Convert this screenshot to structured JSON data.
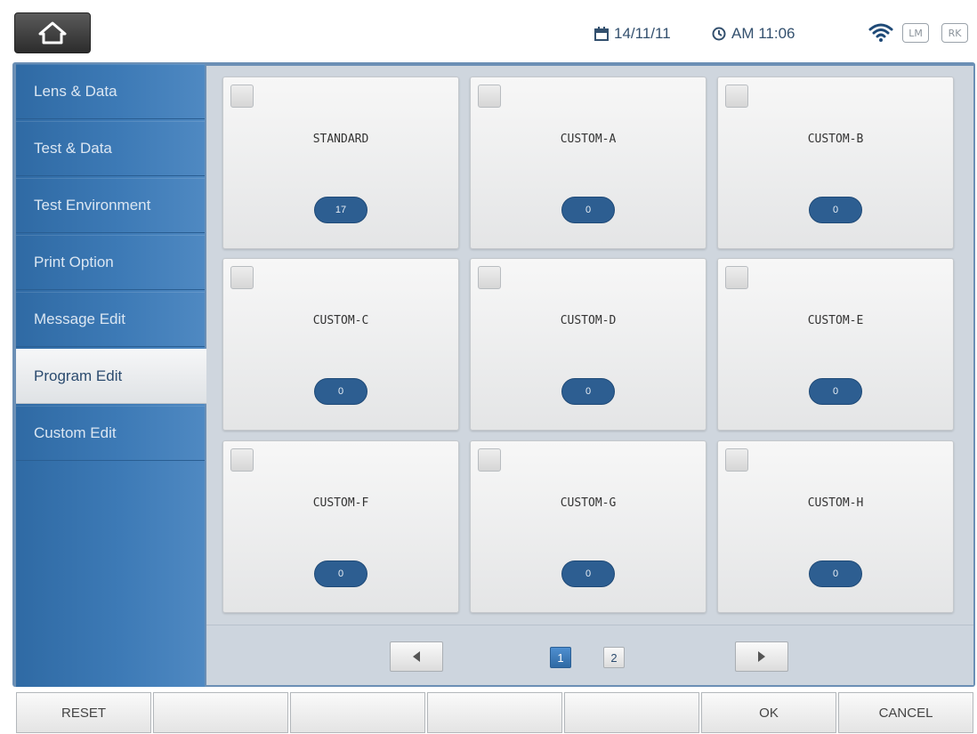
{
  "header": {
    "home_label": "home",
    "date": "14/11/11",
    "time": "AM 11:06",
    "tag_lm": "LM",
    "tag_rk": "RK"
  },
  "sidebar": {
    "items": [
      {
        "label": "Lens & Data"
      },
      {
        "label": "Test & Data"
      },
      {
        "label": "Test Environment"
      },
      {
        "label": "Print Option"
      },
      {
        "label": "Message Edit"
      },
      {
        "label": "Program Edit",
        "active": true
      },
      {
        "label": "Custom Edit"
      }
    ]
  },
  "programs": [
    {
      "name": "STANDARD",
      "count": "17"
    },
    {
      "name": "CUSTOM-A",
      "count": "0"
    },
    {
      "name": "CUSTOM-B",
      "count": "0"
    },
    {
      "name": "CUSTOM-C",
      "count": "0"
    },
    {
      "name": "CUSTOM-D",
      "count": "0"
    },
    {
      "name": "CUSTOM-E",
      "count": "0"
    },
    {
      "name": "CUSTOM-F",
      "count": "0"
    },
    {
      "name": "CUSTOM-G",
      "count": "0"
    },
    {
      "name": "CUSTOM-H",
      "count": "0"
    }
  ],
  "pager": {
    "pages": [
      "1",
      "2"
    ],
    "current": "1"
  },
  "footer": {
    "buttons": [
      "RESET",
      "",
      "",
      "",
      "",
      "OK",
      "CANCEL"
    ]
  },
  "colors": {
    "accent": "#2f6aa4",
    "badge": "#2d5e91"
  }
}
